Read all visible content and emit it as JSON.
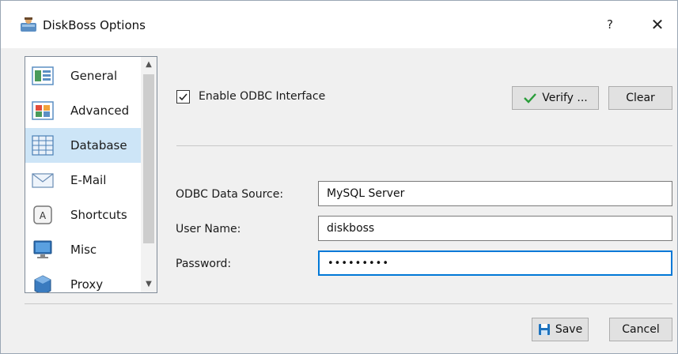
{
  "window": {
    "title": "DiskBoss Options",
    "help_label": "?",
    "close_label": "✕"
  },
  "sidebar": {
    "items": [
      {
        "label": "General",
        "icon": "general-icon",
        "selected": false
      },
      {
        "label": "Advanced",
        "icon": "advanced-icon",
        "selected": false
      },
      {
        "label": "Database",
        "icon": "database-icon",
        "selected": true
      },
      {
        "label": "E-Mail",
        "icon": "email-icon",
        "selected": false
      },
      {
        "label": "Shortcuts",
        "icon": "shortcuts-icon",
        "selected": false
      },
      {
        "label": "Misc",
        "icon": "misc-icon",
        "selected": false
      },
      {
        "label": "Proxy",
        "icon": "proxy-icon",
        "selected": false
      }
    ]
  },
  "odbc": {
    "enable_label": "Enable ODBC Interface",
    "enabled": true,
    "verify_label": "Verify ...",
    "clear_label": "Clear"
  },
  "form": {
    "data_source_label": "ODBC Data Source:",
    "data_source_value": "MySQL Server",
    "user_name_label": "User Name:",
    "user_name_value": "diskboss",
    "password_label": "Password:",
    "password_value": "diskboss1"
  },
  "footer": {
    "save_label": "Save",
    "cancel_label": "Cancel"
  },
  "colors": {
    "selection": "#cde5f7",
    "focus_border": "#0078d7",
    "check_green": "#2a9d3a",
    "save_blue": "#1e73be"
  }
}
